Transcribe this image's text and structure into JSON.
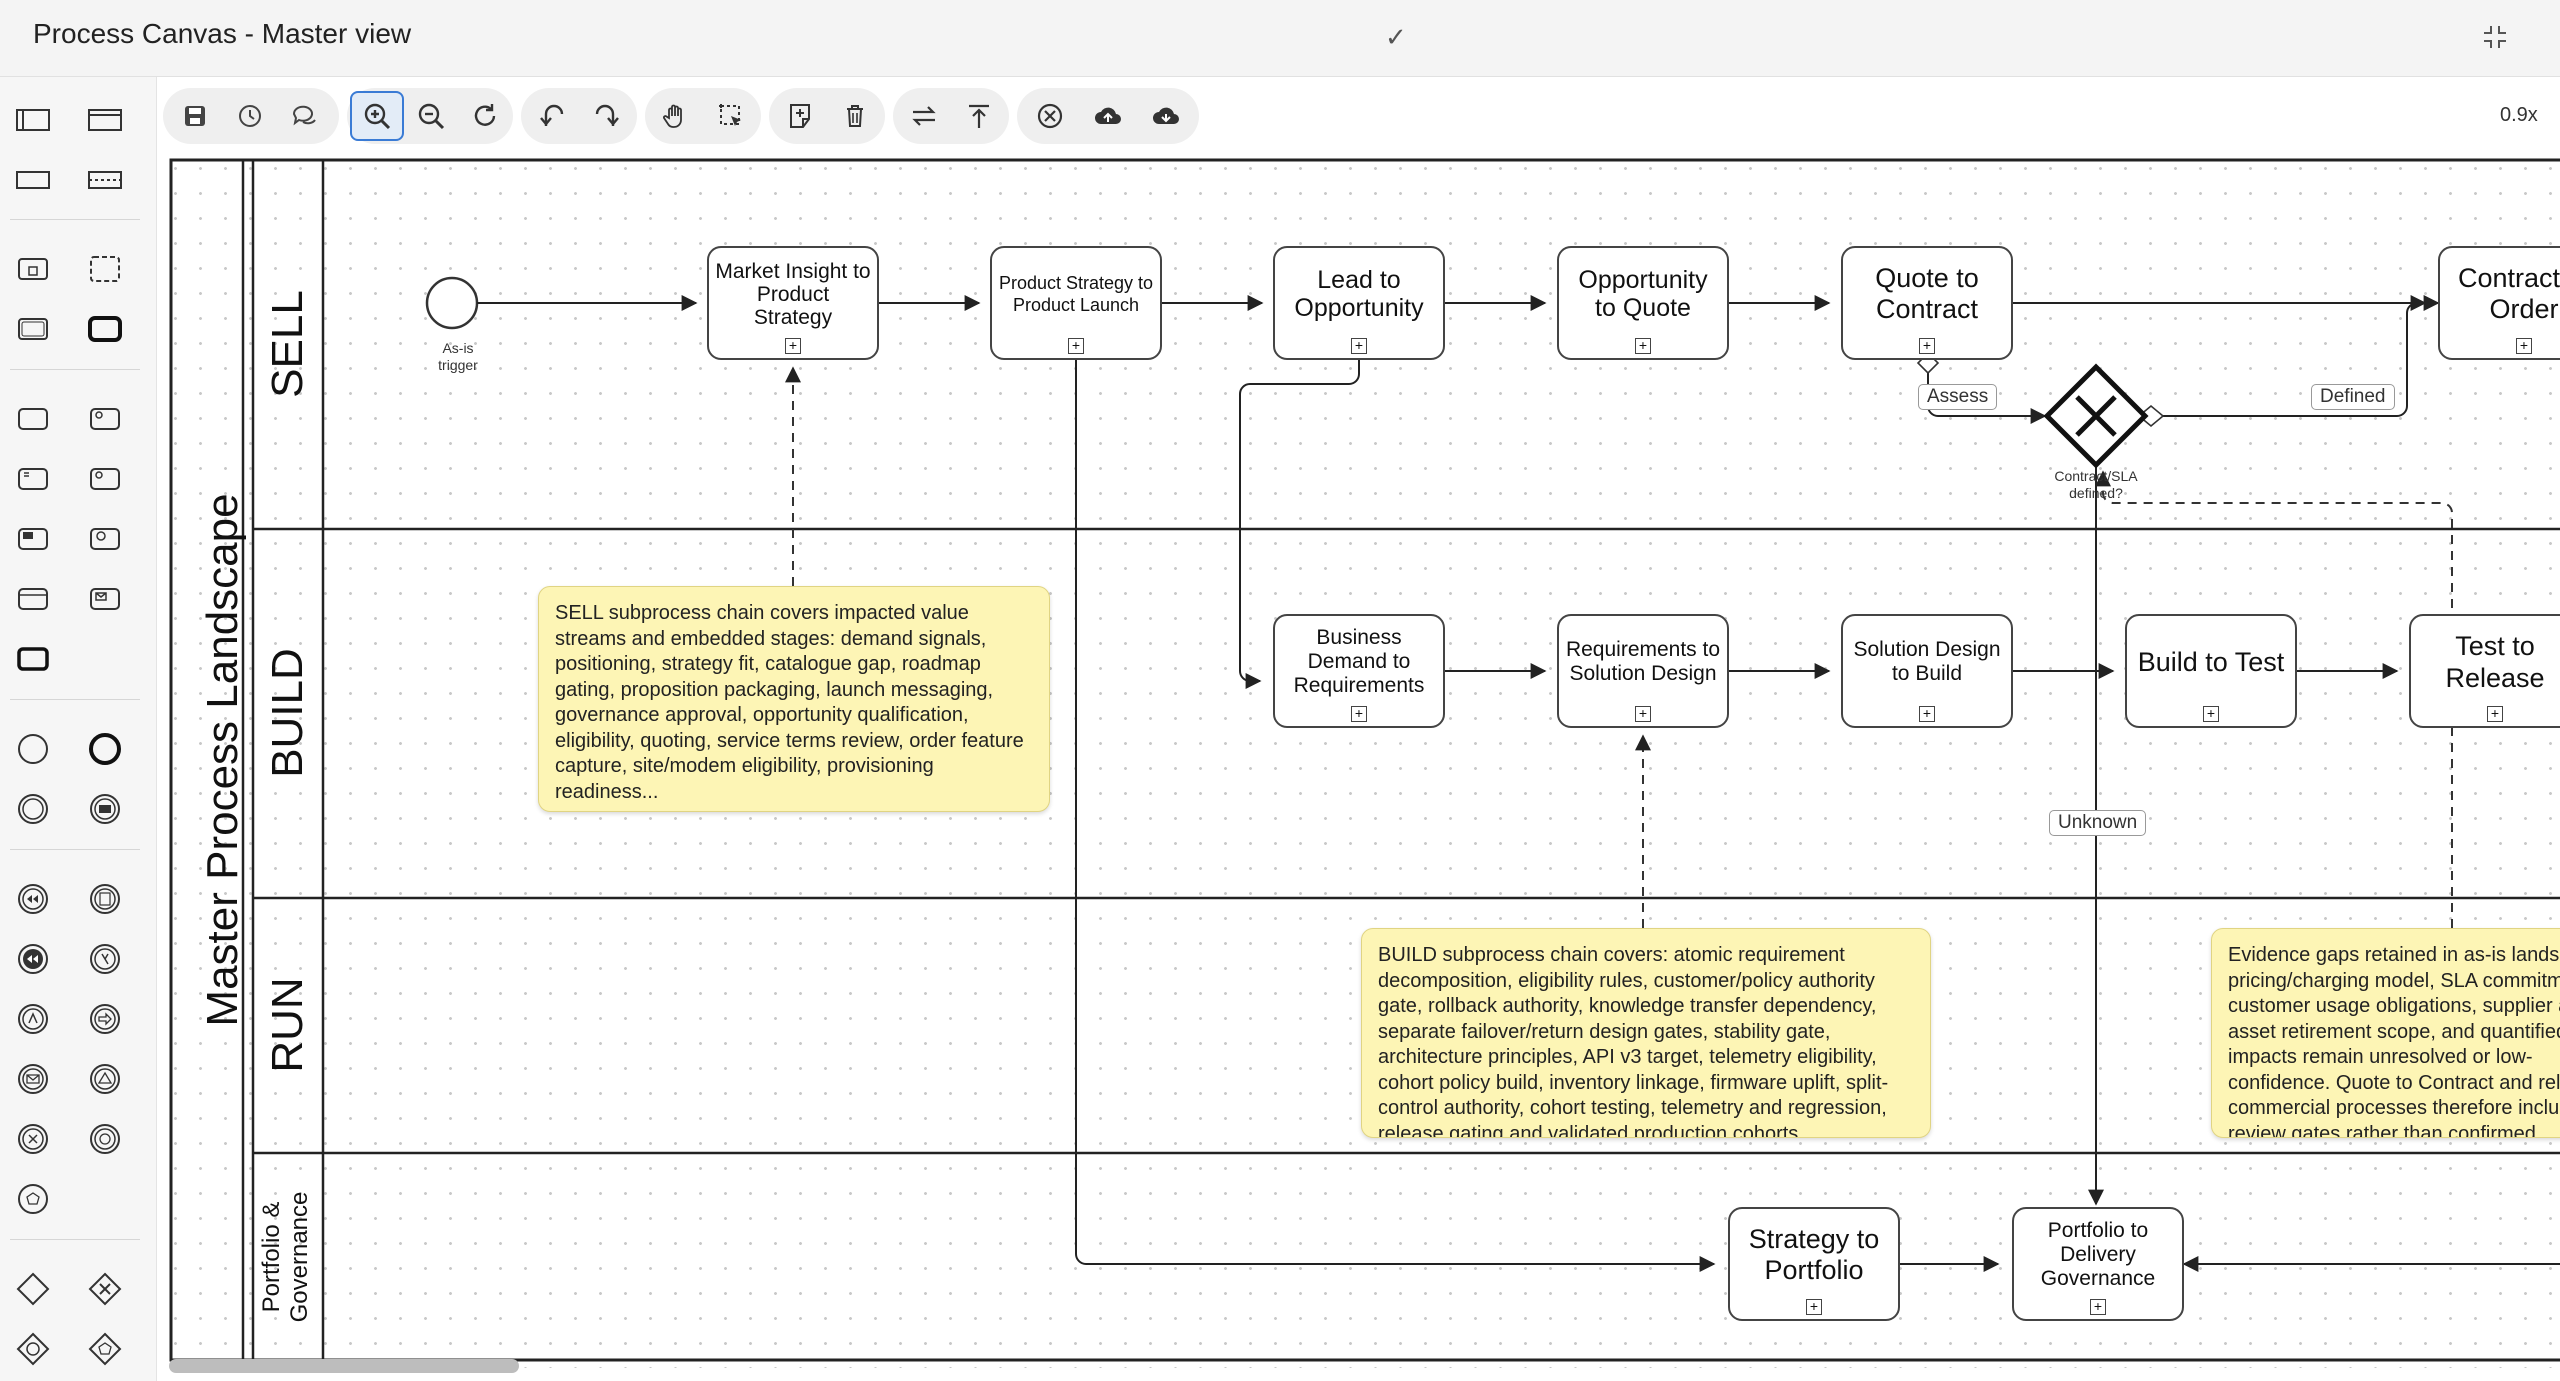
{
  "window": {
    "title": "Process Canvas - Master view"
  },
  "toolbar": {
    "zoom_level": "0.9x"
  },
  "pool": {
    "name": "Master Process Landscape"
  },
  "lanes": {
    "sell": "SELL",
    "build": "BUILD",
    "run": "RUN",
    "portfolio_line1": "Portfolio &",
    "portfolio_line2": "Governance"
  },
  "start_event": {
    "label_line1": "As-is",
    "label_line2": "trigger"
  },
  "tasks": {
    "market_insight": "Market Insight to Product Strategy",
    "product_strategy": "Product Strategy to Product Launch",
    "lead_to_opportunity": "Lead to Opportunity",
    "opportunity_to_quote": "Opportunity to Quote",
    "quote_to_contract": "Quote to Contract",
    "contract_to_order": "Contract to Order",
    "business_demand": "Business Demand to Requirements",
    "requirements_to_solution": "Requirements to Solution Design",
    "solution_design": "Solution Design to Build",
    "build_to_test": "Build to Test",
    "test_to_release": "Test to Release",
    "strategy_to_portfolio": "Strategy to Portfolio",
    "portfolio_to_delivery": "Portfolio to Delivery Governance"
  },
  "gateway": {
    "label_line1": "Contract/SLA",
    "label_line2": "defined?"
  },
  "flow_labels": {
    "assess": "Assess",
    "defined": "Defined",
    "unknown": "Unknown"
  },
  "notes": {
    "sell": "SELL subprocess chain covers impacted value streams and embedded stages: demand signals, positioning, strategy fit, catalogue gap, roadmap gating, proposition packaging, launch messaging, governance approval, opportunity qualification, eligibility, quoting, service terms review, order feature capture, site/modem eligibility, provisioning readiness...",
    "build": "BUILD subprocess chain covers: atomic requirement decomposition, eligibility rules, customer/policy authority gate, rollback authority, knowledge transfer dependency, separate failover/return design gates, stability gate, architecture principles, API v3 target, telemetry eligibility, cohort policy build, inventory linkage, firmware uplift, split-control authority, cohort testing, telemetry and regression, release gating and validated production cohorts.",
    "evidence": "Evidence gaps retained in as-is landscape: pricing/charging model, SLA commitments, customer usage obligations, supplier and asset retirement scope, and quantified impacts remain unresolved or low-confidence. Quote to Contract and related commercial processes therefore include review gates rather than confirmed automated flow."
  }
}
